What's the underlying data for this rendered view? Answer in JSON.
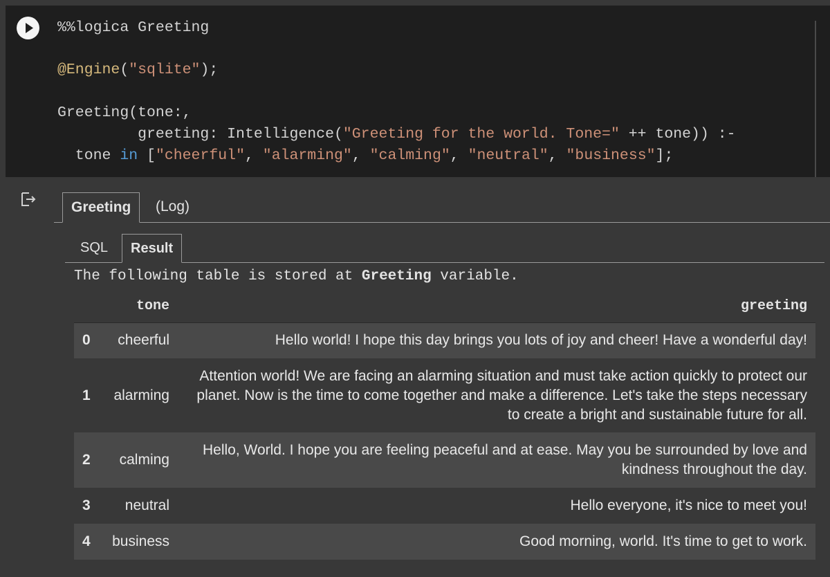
{
  "code": {
    "line1": "%%logica Greeting",
    "line2_decorator": "@Engine",
    "line2_paren_open": "(",
    "line2_string": "\"sqlite\"",
    "line2_end": ");",
    "line3": "Greeting(tone:,",
    "line4_prefix": "         greeting: Intelligence(",
    "line4_string": "\"Greeting for the world. Tone=\"",
    "line4_suffix": " ++ tone)) :-",
    "line5_prefix": "  tone ",
    "line5_kw": "in",
    "line5_open": " [",
    "line5_s1": "\"cheerful\"",
    "line5_s2": "\"alarming\"",
    "line5_s3": "\"calming\"",
    "line5_s4": "\"neutral\"",
    "line5_s5": "\"business\"",
    "line5_sep": ", ",
    "line5_close": "];"
  },
  "output": {
    "outer_tabs": [
      "Greeting",
      "(Log)"
    ],
    "inner_tabs": [
      "SQL",
      "Result"
    ],
    "note_prefix": "The following table is stored at ",
    "note_var": "Greeting",
    "note_suffix": " variable.",
    "table": {
      "headers": [
        "",
        "tone",
        "greeting"
      ],
      "rows": [
        {
          "index": "0",
          "tone": "cheerful",
          "greeting": "Hello world! I hope this day brings you lots of joy and cheer! Have a wonderful day!"
        },
        {
          "index": "1",
          "tone": "alarming",
          "greeting": "Attention world! We are facing an alarming situation and must take action quickly to protect our planet. Now is the time to come together and make a difference. Let's take the steps necessary to create a bright and sustainable future for all."
        },
        {
          "index": "2",
          "tone": "calming",
          "greeting": "Hello, World. I hope you are feeling peaceful and at ease. May you be surrounded by love and kindness throughout the day."
        },
        {
          "index": "3",
          "tone": "neutral",
          "greeting": "Hello everyone, it's nice to meet you!"
        },
        {
          "index": "4",
          "tone": "business",
          "greeting": "Good morning, world. It's time to get to work."
        }
      ]
    }
  },
  "icons": {
    "run": "play-icon",
    "output": "output-redirect-icon"
  }
}
